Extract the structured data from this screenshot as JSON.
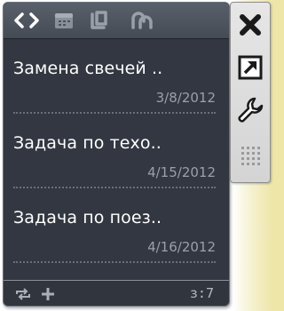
{
  "toolbar": {
    "icons": [
      "code-icon",
      "calendar-icon",
      "copy-icon",
      "link-icon"
    ]
  },
  "tasks": [
    {
      "title": "Замена свечей ..",
      "date": "3/8/2012"
    },
    {
      "title": "Задача по техо..",
      "date": "4/15/2012"
    },
    {
      "title": "Задача по поез..",
      "date": "4/16/2012"
    }
  ],
  "footer": {
    "count": "з:7",
    "icons": [
      "sync-icon",
      "add-icon"
    ]
  },
  "side_panel": {
    "buttons": [
      "close-icon",
      "undock-icon",
      "options-wrench-icon",
      "drag-grip-icon"
    ]
  },
  "colors": {
    "panel_bg": "#323741",
    "toolbar_bg": "#4f5660",
    "title_text": "#ffffff",
    "date_text": "#9aa0aa",
    "desktop_accent": "#eee6a8"
  }
}
